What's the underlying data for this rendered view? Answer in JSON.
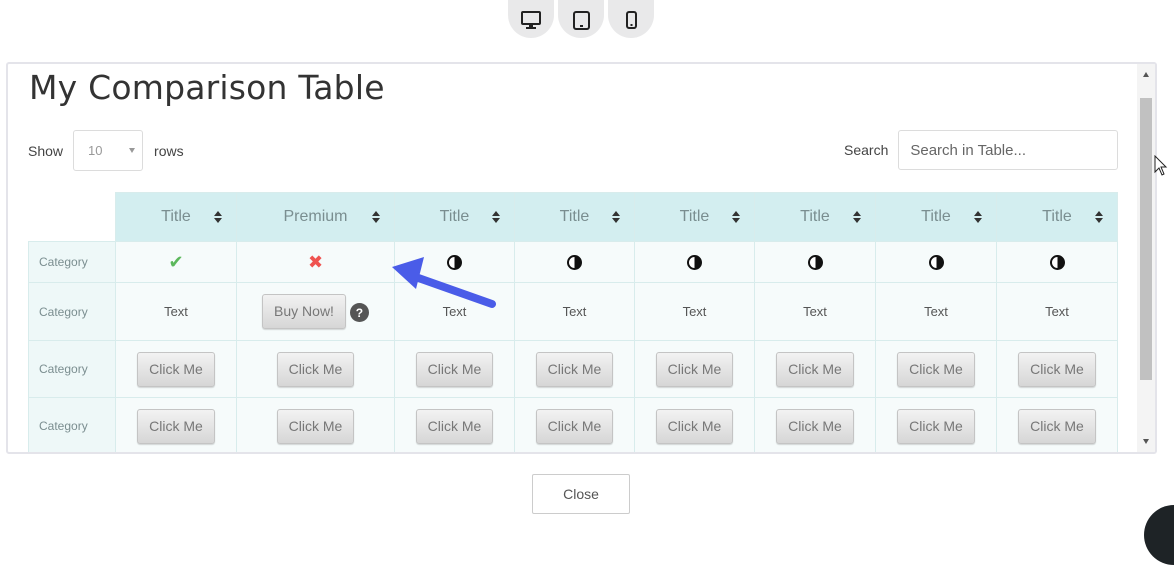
{
  "devices": [
    {
      "icon": "desktop-icon"
    },
    {
      "icon": "tablet-icon"
    },
    {
      "icon": "mobile-icon"
    }
  ],
  "table_title": "My Comparison Table",
  "controls": {
    "show_label": "Show",
    "rows_value": "10",
    "rows_label": "rows",
    "search_label": "Search",
    "search_placeholder": "Search in Table..."
  },
  "columns": [
    "Title",
    "Premium",
    "Title",
    "Title",
    "Title",
    "Title",
    "Title",
    "Title"
  ],
  "rows": [
    {
      "category": "Category",
      "cells": [
        {
          "type": "icon",
          "icon": "check-icon",
          "glyph": "✔"
        },
        {
          "type": "icon",
          "icon": "x-icon",
          "glyph": "✖"
        },
        {
          "type": "icon",
          "icon": "half-circle-icon"
        },
        {
          "type": "icon",
          "icon": "half-circle-icon"
        },
        {
          "type": "icon",
          "icon": "half-circle-icon"
        },
        {
          "type": "icon",
          "icon": "half-circle-icon"
        },
        {
          "type": "icon",
          "icon": "half-circle-icon"
        },
        {
          "type": "icon",
          "icon": "half-circle-icon"
        }
      ]
    },
    {
      "category": "Category",
      "cells": [
        {
          "type": "text",
          "text": "Text"
        },
        {
          "type": "button",
          "text": "Buy Now!",
          "help": "?"
        },
        {
          "type": "text",
          "text": "Text"
        },
        {
          "type": "text",
          "text": "Text"
        },
        {
          "type": "text",
          "text": "Text"
        },
        {
          "type": "text",
          "text": "Text"
        },
        {
          "type": "text",
          "text": "Text"
        },
        {
          "type": "text",
          "text": "Text"
        }
      ]
    },
    {
      "category": "Category",
      "cells": [
        {
          "type": "button",
          "text": "Click Me"
        },
        {
          "type": "button",
          "text": "Click Me"
        },
        {
          "type": "button",
          "text": "Click Me"
        },
        {
          "type": "button",
          "text": "Click Me"
        },
        {
          "type": "button",
          "text": "Click Me"
        },
        {
          "type": "button",
          "text": "Click Me"
        },
        {
          "type": "button",
          "text": "Click Me"
        },
        {
          "type": "button",
          "text": "Click Me"
        }
      ]
    },
    {
      "category": "Category",
      "cells": [
        {
          "type": "button",
          "text": "Click Me"
        },
        {
          "type": "button",
          "text": "Click Me"
        },
        {
          "type": "button",
          "text": "Click Me"
        },
        {
          "type": "button",
          "text": "Click Me"
        },
        {
          "type": "button",
          "text": "Click Me"
        },
        {
          "type": "button",
          "text": "Click Me"
        },
        {
          "type": "button",
          "text": "Click Me"
        },
        {
          "type": "button",
          "text": "Click Me"
        }
      ]
    }
  ],
  "close_label": "Close",
  "colors": {
    "header_bg": "#d3eef0",
    "cell_bg": "#f6fbfb",
    "check": "#5cb85c",
    "cross": "#ef5350",
    "annotation_arrow": "#4a5ce8"
  }
}
